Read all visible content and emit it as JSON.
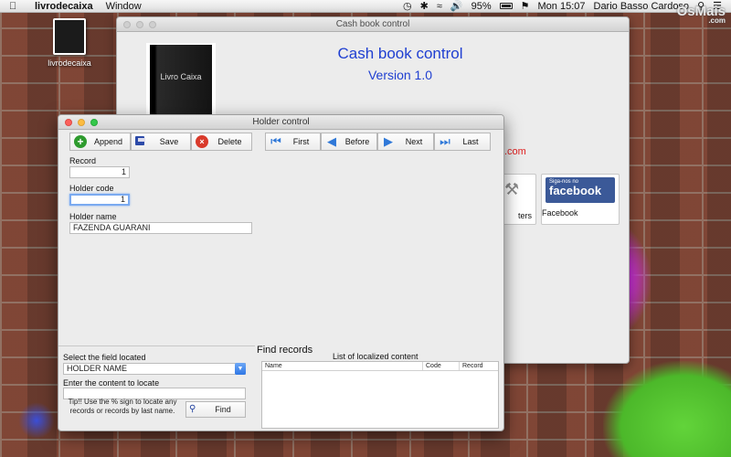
{
  "menubar": {
    "app_name": "livrodecaixa",
    "menu_window": "Window",
    "battery": "95%",
    "clock": "Mon 15:07",
    "user": "Dario Basso Cardoso",
    "brand": "OsMais",
    "brand_sub": ".com"
  },
  "desktop_icon": {
    "caption": "livrodecaixa"
  },
  "main_window": {
    "title": "Cash book control",
    "book_label": "Livro Caixa",
    "heading": "Cash book control",
    "version": "Version 1.0",
    "link_fragment": ".com",
    "params_label": "ters",
    "facebook_badge_small": "Siga-nos no",
    "facebook_badge_big": "facebook",
    "facebook_label": "Facebook"
  },
  "holder_window": {
    "title": "Holder control",
    "toolbar": {
      "append": "Append",
      "save": "Save",
      "delete": "Delete",
      "first": "First",
      "before": "Before",
      "next": "Next",
      "last": "Last"
    },
    "record_label": "Record",
    "record_value": "1",
    "holder_code_label": "Holder code",
    "holder_code_value": "1",
    "holder_name_label": "Holder name",
    "holder_name_value": "FAZENDA GUARANI"
  },
  "search": {
    "field_label": "Select the field located",
    "field_selected": "HOLDER NAME",
    "content_label": "Enter the content to locate",
    "content_value": "",
    "tip": "Tip!! Use the % sign to locate any records or records by last name.",
    "find_button": "Find"
  },
  "results": {
    "title": "Find records",
    "caption": "List of localized content",
    "columns": [
      "Name",
      "Code",
      "Record"
    ]
  },
  "colors": {
    "accent_blue": "#1f3fd1",
    "link_red": "#e02020",
    "facebook": "#3b5998"
  }
}
